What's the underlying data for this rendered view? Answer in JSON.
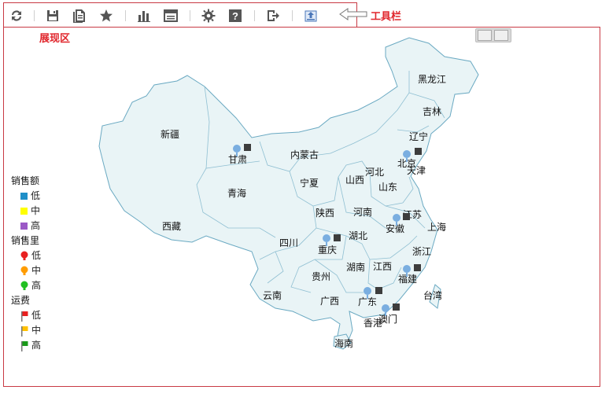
{
  "toolbar": {
    "label": "工具栏",
    "buttons": [
      {
        "name": "refresh-icon",
        "x": 0
      },
      {
        "name": "save-icon",
        "x": 1
      },
      {
        "name": "save-as-icon",
        "x": 2
      },
      {
        "name": "favorite-star-icon",
        "x": 3
      },
      {
        "name": "chart-icon",
        "x": 4
      },
      {
        "name": "layout-icon",
        "x": 5
      },
      {
        "name": "settings-gear-icon",
        "x": 6
      },
      {
        "name": "help-icon",
        "x": 7
      },
      {
        "name": "exit-icon",
        "x": 8
      },
      {
        "name": "export-icon",
        "x": 9
      }
    ]
  },
  "display_area": {
    "label": "展现区"
  },
  "map": {
    "provinces": [
      "黑龙江",
      "吉林",
      "辽宁",
      "新疆",
      "内蒙古",
      "甘肃",
      "北京",
      "天津",
      "河北",
      "宁夏",
      "山西",
      "山东",
      "青海",
      "陕西",
      "河南",
      "江苏",
      "安徽",
      "上海",
      "西藏",
      "四川",
      "湖北",
      "重庆",
      "浙江",
      "湖南",
      "江西",
      "福建",
      "贵州",
      "云南",
      "广西",
      "广东",
      "台湾",
      "澳门",
      "香港",
      "海南"
    ]
  },
  "legend": {
    "sales_amount": {
      "title": "销售额",
      "items": [
        {
          "label": "低",
          "color": "#1f8fc8"
        },
        {
          "label": "中",
          "color": "#ffff00"
        },
        {
          "label": "高",
          "color": "#9b59c6"
        }
      ]
    },
    "sales_volume": {
      "title": "销售里",
      "items": [
        {
          "label": "低",
          "color": "#e82020"
        },
        {
          "label": "中",
          "color": "#ff9c00"
        },
        {
          "label": "高",
          "color": "#21c021"
        }
      ]
    },
    "freight": {
      "title": "运费",
      "items": [
        {
          "label": "低",
          "color": "#e82020"
        },
        {
          "label": "中",
          "color": "#ffc000"
        },
        {
          "label": "高",
          "color": "#1a9a1a"
        }
      ]
    }
  }
}
